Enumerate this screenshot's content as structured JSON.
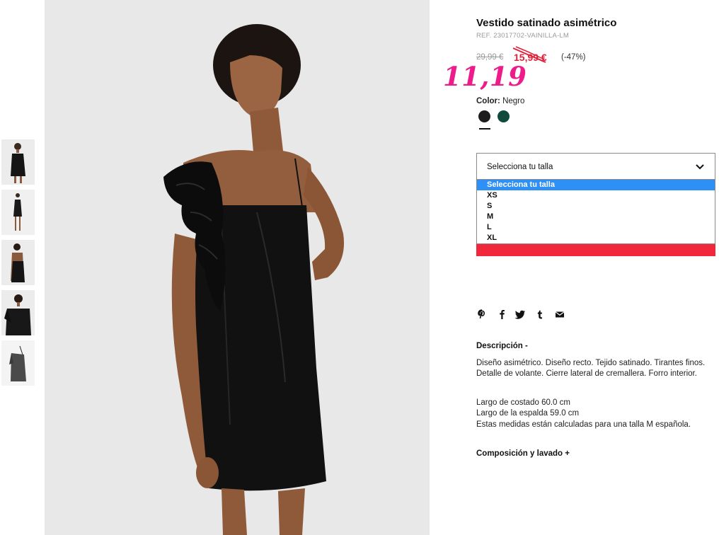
{
  "product": {
    "title": "Vestido satinado asimétrico",
    "ref": "REF. 23017702-VAINILLA-LM",
    "price_old": "29,99 €",
    "price_sale": "15,99 €",
    "discount": "(-47%)",
    "handwritten_price": "11,19"
  },
  "color": {
    "label": "Color:",
    "value": "Negro",
    "swatches": [
      "#1d1d1d",
      "#0f4a3c"
    ]
  },
  "size": {
    "select_label": "Selecciona tu talla",
    "options": [
      "Selecciona tu talla",
      "XS",
      "S",
      "M",
      "L",
      "XL"
    ],
    "highlighted_option": "Selecciona tu talla"
  },
  "share": {
    "icons": [
      "pinterest-icon",
      "facebook-icon",
      "twitter-icon",
      "tumblr-icon",
      "email-icon"
    ]
  },
  "description": {
    "title": "Descripción -",
    "text": "Diseño asimétrico. Diseño recto. Tejido satinado. Tirantes finos. Detalle de volante. Cierre lateral de cremallera. Forro interior.",
    "measures": [
      "Largo de costado 60.0 cm",
      "Largo de la espalda 59.0 cm",
      "Estas medidas están calculadas para una talla M española."
    ]
  },
  "composition": {
    "title": "Composición y lavado +"
  },
  "colors": {
    "sale_red": "#e0223a",
    "button_red": "#f1283b",
    "dropdown_highlight": "#2e8ff5",
    "handwriting_pink": "#ee1b8b"
  }
}
